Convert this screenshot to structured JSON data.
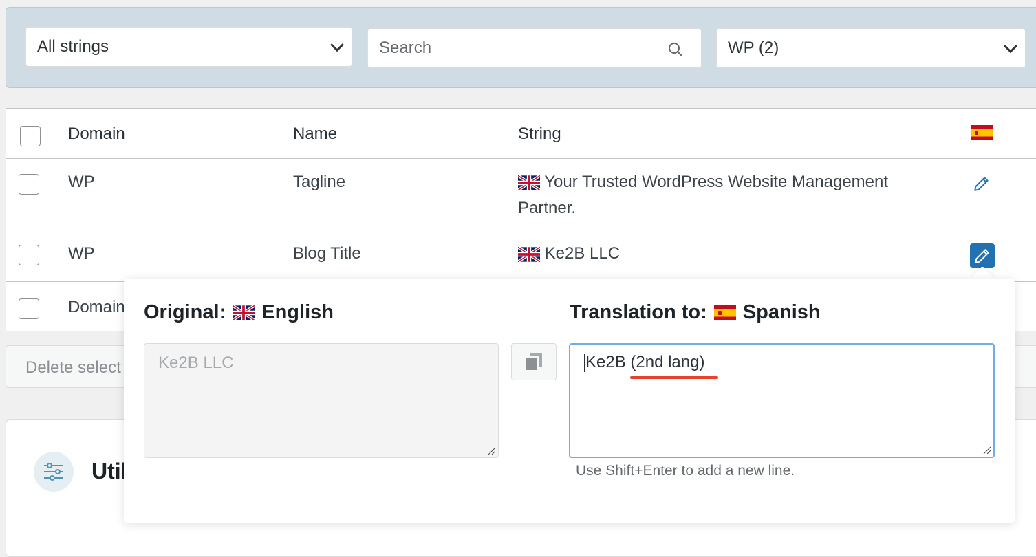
{
  "filters": {
    "type_select": "All strings",
    "search_placeholder": "Search",
    "domain_select": "WP (2)"
  },
  "table": {
    "headers": {
      "domain": "Domain",
      "name": "Name",
      "string": "String"
    },
    "rows": [
      {
        "domain": "WP",
        "name": "Tagline",
        "string": "Your Trusted WordPress Website Management Partner."
      },
      {
        "domain": "WP",
        "name": "Blog Title",
        "string": "Ke2B LLC"
      },
      {
        "domain": "Domain",
        "name": "",
        "string": ""
      }
    ]
  },
  "bulk": {
    "delete_label": "Delete select"
  },
  "utilities": {
    "title": "Util"
  },
  "popup": {
    "original_label": "Original:",
    "original_language": "English",
    "translation_label": "Translation to:",
    "translation_language": "Spanish",
    "original_text": "Ke2B LLC",
    "translation_text": "Ke2B (2nd lang)",
    "hint": "Use Shift+Enter to add a new line."
  },
  "icons": {
    "flags": [
      "flag-uk-icon",
      "flag-es-icon"
    ],
    "actions": [
      "search-icon",
      "chevron-down-icon",
      "pencil-icon",
      "copy-icon",
      "settings-sliders-icon"
    ]
  },
  "colors": {
    "accent": "#2271b1",
    "filter_bg": "#d0dce4",
    "highlight": "#e6432a",
    "focus": "#72aee6"
  }
}
